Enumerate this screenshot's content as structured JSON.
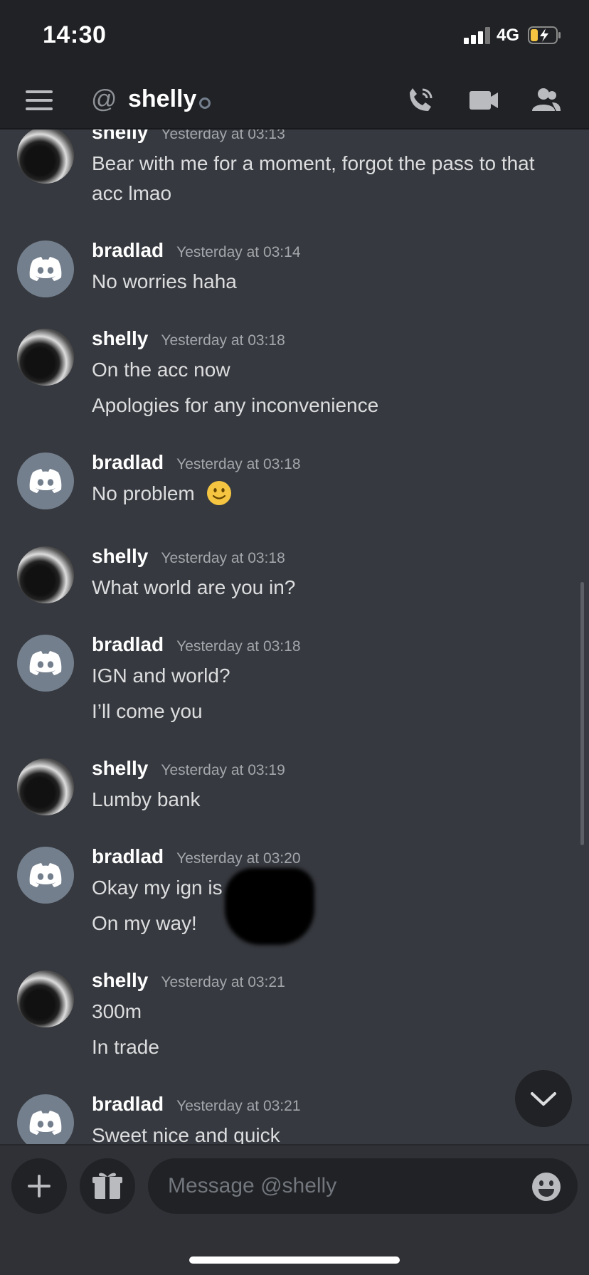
{
  "status_bar": {
    "time": "14:30",
    "network": "4G"
  },
  "header": {
    "title": "shelly",
    "at_symbol": "@"
  },
  "messages": [
    {
      "user": "shelly",
      "time": "Yesterday at 03:13",
      "lines": [
        "Bear with me for a moment, forgot the pass to that",
        "acc lmao"
      ]
    },
    {
      "user": "bradlad",
      "time": "Yesterday at 03:14",
      "lines": [
        "No worries haha"
      ]
    },
    {
      "user": "shelly",
      "time": "Yesterday at 03:18",
      "lines": [
        "On the acc now",
        "Apologies for any inconvenience"
      ]
    },
    {
      "user": "bradlad",
      "time": "Yesterday at 03:18",
      "lines": [
        "No problem"
      ]
    },
    {
      "user": "shelly",
      "time": "Yesterday at 03:18",
      "lines": [
        "What world are you in?"
      ]
    },
    {
      "user": "bradlad",
      "time": "Yesterday at 03:18",
      "lines": [
        "IGN and world?",
        "I’ll come you"
      ]
    },
    {
      "user": "shelly",
      "time": "Yesterday at 03:19",
      "lines": [
        "Lumby bank"
      ]
    },
    {
      "user": "bradlad",
      "time": "Yesterday at 03:20",
      "lines": [
        "Okay my ign is",
        "On my way!"
      ]
    },
    {
      "user": "shelly",
      "time": "Yesterday at 03:21",
      "lines": [
        "300m",
        "In trade"
      ]
    },
    {
      "user": "bradlad",
      "time": "Yesterday at 03:21",
      "lines": [
        "Sweet nice and quick"
      ]
    }
  ],
  "composer": {
    "placeholder": "Message @shelly"
  },
  "colors": {
    "background": "#36393f",
    "header": "#202225",
    "emoji": "#f5c542",
    "battery": "#f5c542"
  },
  "icons": [
    "hamburger-icon",
    "at-icon",
    "phone-call-icon",
    "video-camera-icon",
    "members-icon",
    "chevron-down-icon",
    "plus-icon",
    "gift-icon",
    "emoji-icon",
    "discord-logo-icon"
  ]
}
